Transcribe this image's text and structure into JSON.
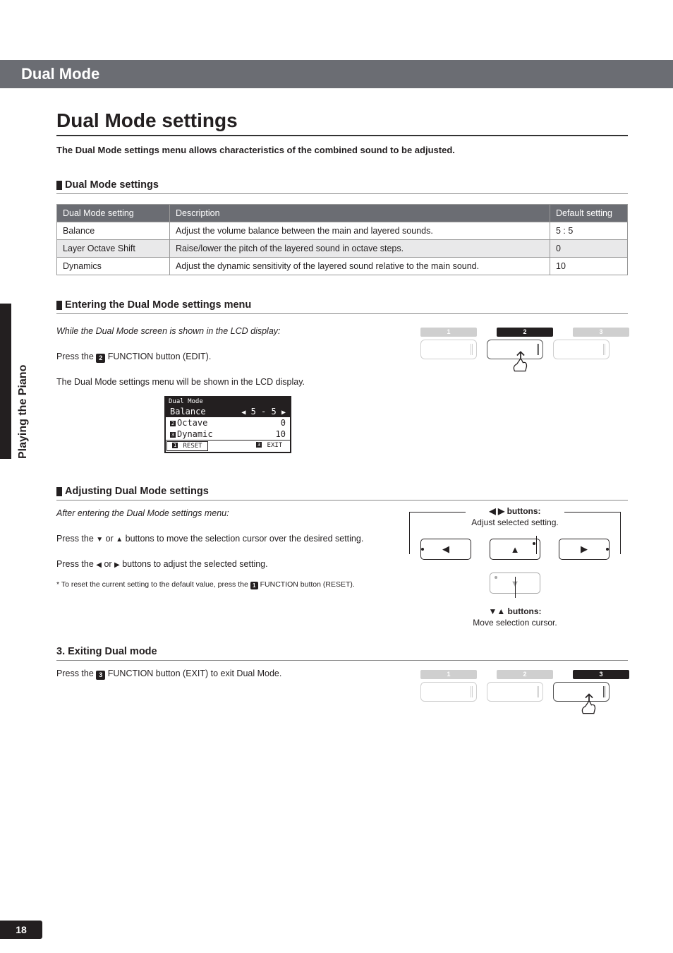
{
  "side_text": "Playing the Piano",
  "page_number": "18",
  "banner": "Dual Mode",
  "title": "Dual Mode settings",
  "intro": "The Dual Mode settings menu allows characteristics of the combined sound to be adjusted.",
  "sub_settings": "Dual Mode settings",
  "table": {
    "head": {
      "c1": "Dual Mode setting",
      "c2": "Description",
      "c3": "Default setting"
    },
    "rows": [
      {
        "c1": "Balance",
        "c2": "Adjust the volume balance between the main and layered sounds.",
        "c3": "5 : 5"
      },
      {
        "c1": "Layer Octave Shift",
        "c2": "Raise/lower the pitch of the layered sound in octave steps.",
        "c3": "0"
      },
      {
        "c1": "Dynamics",
        "c2": "Adjust the dynamic sensitivity of the layered sound relative to the main sound.",
        "c3": "10"
      }
    ]
  },
  "sec_enter": {
    "heading": "Entering the Dual Mode settings menu",
    "lead": "While the Dual Mode screen is shown in the LCD display:",
    "press_pre": "Press the ",
    "press_num": "2",
    "press_post": " FUNCTION button (EDIT).",
    "result": "The Dual Mode settings menu will be shown in the LCD display.",
    "lcd": {
      "title": "Dual Mode",
      "rows": [
        {
          "label": "Balance",
          "val": "5 - 5",
          "sel": true,
          "arrows": true
        },
        {
          "label": "Octave",
          "val": "0",
          "mark": "2"
        },
        {
          "label": "Dynamic",
          "val": "10",
          "mark": "3"
        }
      ],
      "foot": {
        "left_mark": "1",
        "left": " RESET ",
        "right_mark": "3",
        "right": " EXIT "
      }
    }
  },
  "sec_adjust": {
    "heading": "Adjusting Dual Mode settings",
    "lead": "After entering the Dual Mode settings menu:",
    "p1_pre": "Press the ",
    "p1_mid": " or ",
    "p1_post": " buttons to move the selection cursor over the desired setting.",
    "p2_pre": "Press the ",
    "p2_mid": " or ",
    "p2_post": " buttons to adjust the selected setting.",
    "note_pre": "* To reset the current setting to the default value, press the ",
    "note_num": "1",
    "note_post": " FUNCTION button (RESET).",
    "diagram": {
      "top_label_arrows": "◀ ▶",
      "top_label": " buttons:",
      "top_desc": "Adjust selected setting.",
      "bot_label_arrows": "▼▲",
      "bot_label": " buttons:",
      "bot_desc": "Move selection cursor."
    }
  },
  "sec_exit": {
    "heading": "3. Exiting Dual mode",
    "p_pre": "Press the ",
    "p_num": "3",
    "p_post": " FUNCTION button (EXIT) to exit Dual Mode."
  },
  "diagram_nums": {
    "n1": "1",
    "n2": "2",
    "n3": "3"
  },
  "arrows": {
    "left": "◀",
    "right": "▶",
    "up": "▲",
    "down": "▼"
  }
}
